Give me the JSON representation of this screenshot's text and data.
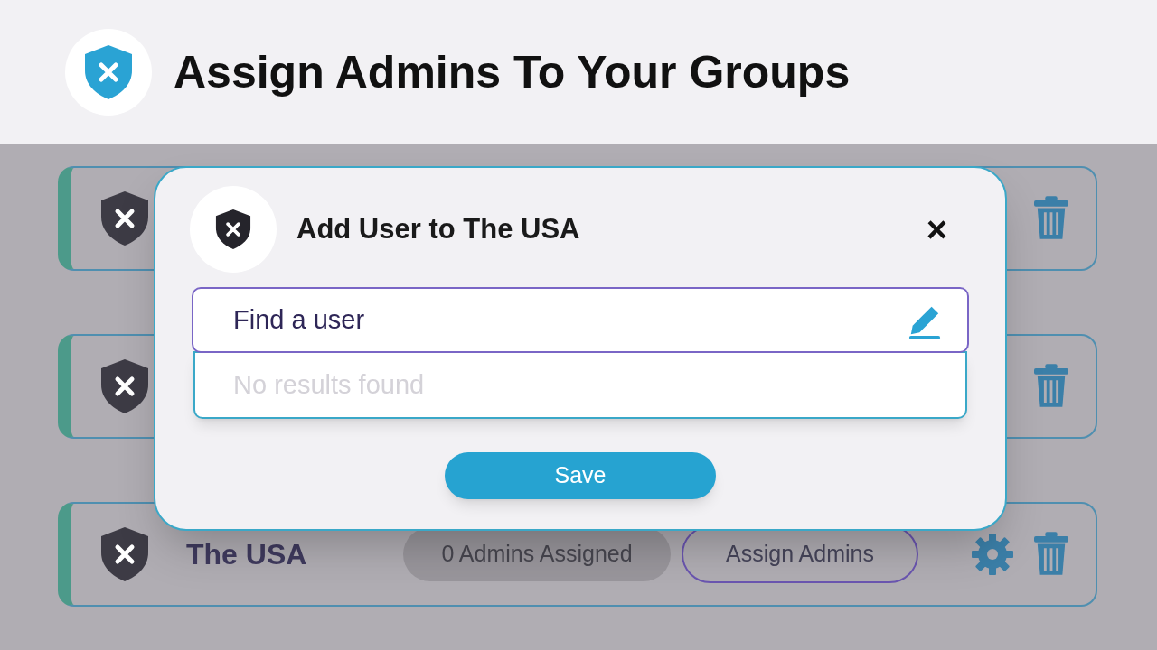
{
  "header": {
    "title": "Assign Admins To Your Groups"
  },
  "groups": [
    {
      "kind": "covered"
    },
    {
      "kind": "covered"
    },
    {
      "kind": "full",
      "name": "The USA",
      "admins_badge": "0 Admins Assigned",
      "assign_button": "Assign Admins"
    }
  ],
  "dialog": {
    "title": "Add User to The USA",
    "close": "×",
    "search": {
      "placeholder": "Find a user"
    },
    "results_message": "No results found",
    "save_button": "Save"
  }
}
